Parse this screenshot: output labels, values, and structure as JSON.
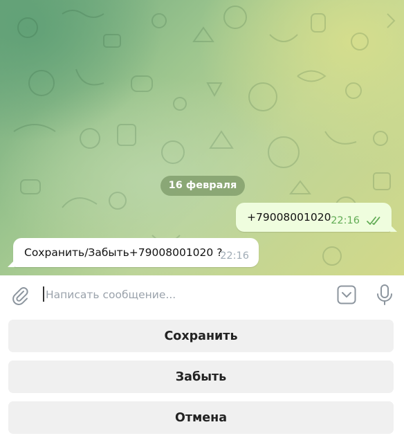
{
  "chat": {
    "date_label": "16 февраля",
    "messages": [
      {
        "direction": "outgoing",
        "text": "+79008001020",
        "time": "22:16",
        "status": "read"
      },
      {
        "direction": "incoming",
        "text": "Сохранить/Забыть+79008001020 ?",
        "time": "22:16"
      }
    ]
  },
  "composer": {
    "placeholder": "Написать сообщение...",
    "value": "",
    "icons": {
      "attach": "paperclip-icon",
      "keyboard_toggle": "chevron-down-icon",
      "mic": "microphone-icon"
    }
  },
  "keyboard": {
    "buttons": [
      {
        "label": "Сохранить"
      },
      {
        "label": "Забыть"
      },
      {
        "label": "Отмена"
      }
    ]
  },
  "colors": {
    "outgoing_bubble": "#effdde",
    "incoming_bubble": "#ffffff",
    "read_checks": "#62ac55",
    "keyboard_button": "#f0f0f0",
    "icon_gray": "#8c959e"
  }
}
